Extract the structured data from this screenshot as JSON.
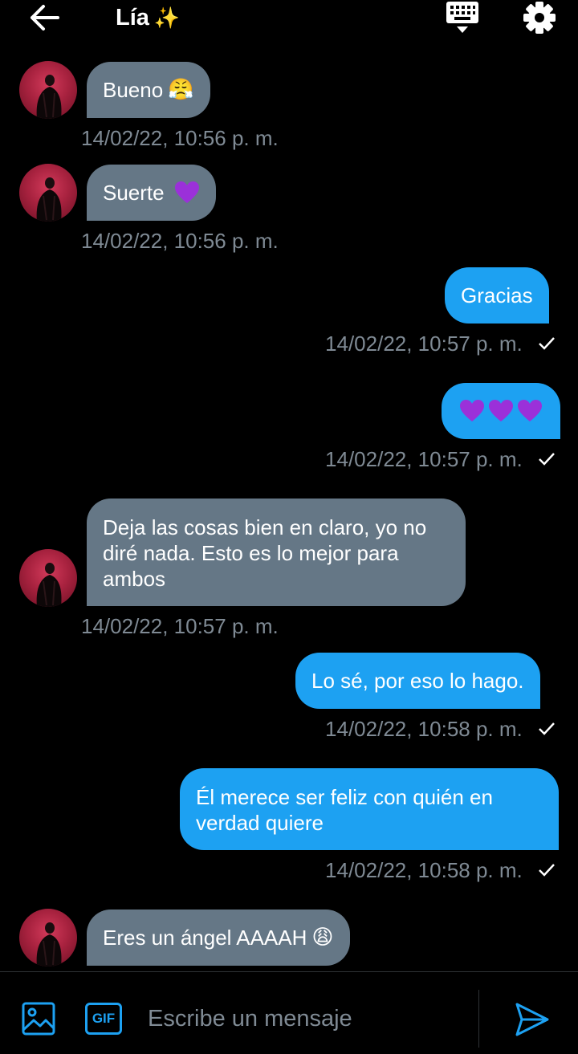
{
  "header": {
    "title": "Lía",
    "title_emoji": "✨",
    "back_icon": "arrow-left-icon",
    "keyboard_icon": "keyboard-icon",
    "settings_icon": "gear-icon"
  },
  "messages": [
    {
      "direction": "in",
      "text": "Bueno",
      "emoji": "😤",
      "timestamp": "14/02/22, 10:56 p. m."
    },
    {
      "direction": "in",
      "text": "Suerte",
      "emoji": "💜",
      "timestamp": "14/02/22, 10:56 p. m."
    },
    {
      "direction": "out",
      "text": "Gracias",
      "timestamp": "14/02/22, 10:57 p. m.",
      "read": true
    },
    {
      "direction": "out",
      "text": "💜💜💜",
      "timestamp": "14/02/22, 10:57 p. m.",
      "read": true
    },
    {
      "direction": "in",
      "line1": "Deja las cosas bien en claro, yo no",
      "line2": "diré nada. Esto es lo mejor para",
      "line3": "ambos",
      "timestamp": "14/02/22, 10:57 p. m."
    },
    {
      "direction": "out",
      "text": "Lo sé, por eso lo hago.",
      "timestamp": "14/02/22, 10:58 p. m.",
      "read": true
    },
    {
      "direction": "out",
      "line1": "Él merece ser feliz con quién en",
      "line2": "verdad quiere",
      "timestamp": "14/02/22, 10:58 p. m.",
      "read": true
    },
    {
      "direction": "in",
      "text": "Eres un ángel AAAAH",
      "emoji": "😩"
    }
  ],
  "composer": {
    "gif_label": "GIF",
    "placeholder": "Escribe un mensaje",
    "image_icon": "image-icon",
    "send_icon": "send-icon"
  },
  "colors": {
    "background": "#000000",
    "incoming_bubble": "#657786",
    "outgoing_bubble": "#1da1f2",
    "timestamp": "#7f8a94",
    "heart": "#9b30d9"
  }
}
